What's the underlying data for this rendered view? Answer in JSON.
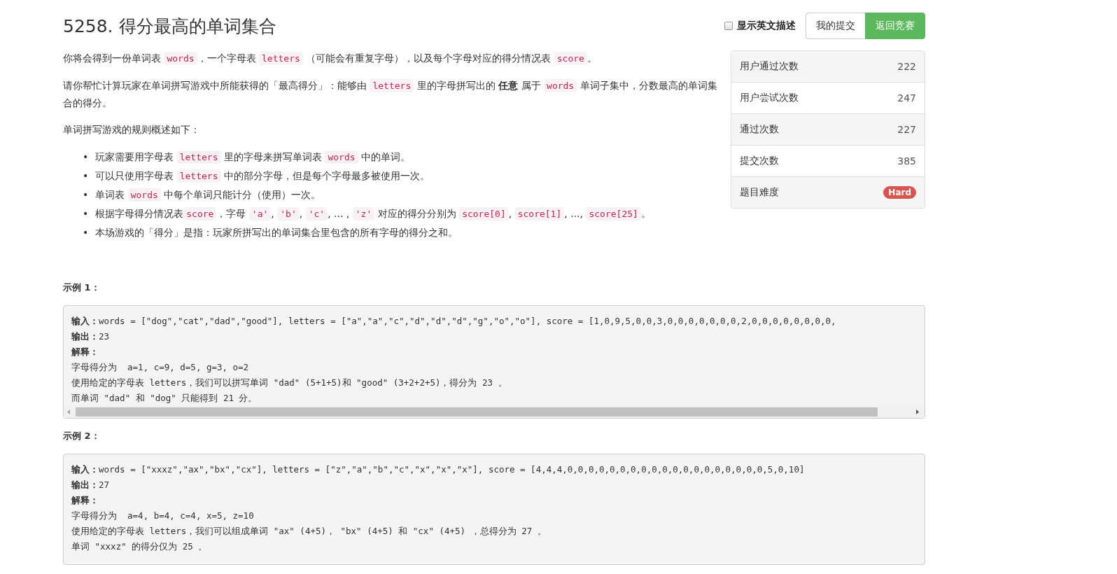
{
  "title": "5258. 得分最高的单词集合",
  "english_toggle": {
    "label": "显示英文描述",
    "checked": false
  },
  "buttons": [
    {
      "label": "我的提交",
      "kind": "default"
    },
    {
      "label": "返回竞赛",
      "kind": "success"
    }
  ],
  "stats": [
    {
      "label": "用户通过次数",
      "value": "222",
      "kind": "count"
    },
    {
      "label": "用户尝试次数",
      "value": "247",
      "kind": "count"
    },
    {
      "label": "通过次数",
      "value": "227",
      "kind": "count"
    },
    {
      "label": "提交次数",
      "value": "385",
      "kind": "count"
    },
    {
      "label": "题目难度",
      "value": "Hard",
      "kind": "badge",
      "color": "#d9534f"
    }
  ],
  "description": [
    [
      {
        "kind": "plain",
        "text": "你将会得到一份单词表 "
      },
      {
        "kind": "code",
        "text": "words"
      },
      {
        "kind": "plain",
        "text": "，一个字母表 "
      },
      {
        "kind": "code",
        "text": "letters"
      },
      {
        "kind": "plain",
        "text": " （可能会有重复字母），以及每个字母对应的得分情况表 "
      },
      {
        "kind": "code",
        "text": "score"
      },
      {
        "kind": "plain",
        "text": "。"
      }
    ],
    [
      {
        "kind": "plain",
        "text": "请你帮忙计算玩家在单词拼写游戏中所能获得的「最高得分」：能够由 "
      },
      {
        "kind": "code",
        "text": "letters"
      },
      {
        "kind": "plain",
        "text": " 里的字母拼写出的 "
      },
      {
        "kind": "bold",
        "text": "任意"
      },
      {
        "kind": "plain",
        "text": " 属于 "
      },
      {
        "kind": "code",
        "text": "words"
      },
      {
        "kind": "plain",
        "text": " 单词子集中，分数最高的单词集合的得分。"
      }
    ],
    [
      {
        "kind": "plain",
        "text": "单词拼写游戏的规则概述如下："
      }
    ]
  ],
  "rules": [
    {
      "marker": "•",
      "segments": [
        {
          "kind": "plain",
          "text": "玩家需要用字母表 "
        },
        {
          "kind": "code",
          "text": "letters"
        },
        {
          "kind": "plain",
          "text": " 里的字母来拼写单词表 "
        },
        {
          "kind": "code",
          "text": "words"
        },
        {
          "kind": "plain",
          "text": " 中的单词。"
        }
      ]
    },
    {
      "marker": "•",
      "segments": [
        {
          "kind": "plain",
          "text": "可以只使用字母表 "
        },
        {
          "kind": "code",
          "text": "letters"
        },
        {
          "kind": "plain",
          "text": " 中的部分字母，但是每个字母最多被使用一次。"
        }
      ]
    },
    {
      "marker": "•",
      "segments": [
        {
          "kind": "plain",
          "text": "单词表 "
        },
        {
          "kind": "code",
          "text": "words"
        },
        {
          "kind": "plain",
          "text": " 中每个单词只能计分（使用）一次。"
        }
      ]
    },
    {
      "marker": "•",
      "segments": [
        {
          "kind": "plain",
          "text": "根据字母得分情况表"
        },
        {
          "kind": "code",
          "text": "score"
        },
        {
          "kind": "plain",
          "text": "，字母 "
        },
        {
          "kind": "code",
          "text": "'a'"
        },
        {
          "kind": "plain",
          "text": ", "
        },
        {
          "kind": "code",
          "text": "'b'"
        },
        {
          "kind": "plain",
          "text": ", "
        },
        {
          "kind": "code",
          "text": "'c'"
        },
        {
          "kind": "plain",
          "text": ", ... , "
        },
        {
          "kind": "code",
          "text": "'z'"
        },
        {
          "kind": "plain",
          "text": " 对应的得分分别为 "
        },
        {
          "kind": "code",
          "text": "score[0]"
        },
        {
          "kind": "plain",
          "text": ", "
        },
        {
          "kind": "code",
          "text": "score[1]"
        },
        {
          "kind": "plain",
          "text": ", ..., "
        },
        {
          "kind": "code",
          "text": "score[25]"
        },
        {
          "kind": "plain",
          "text": "。"
        }
      ]
    },
    {
      "marker": "•",
      "segments": [
        {
          "kind": "plain",
          "text": "本场游戏的「得分」是指：玩家所拼写出的单词集合里包含的所有字母的得分之和。"
        }
      ]
    }
  ],
  "examples": [
    {
      "heading": "示例 1：",
      "scrollable": true,
      "lines": [
        "**输入：**words = [\"dog\",\"cat\",\"dad\",\"good\"], letters = [\"a\",\"a\",\"c\",\"d\",\"d\",\"d\",\"g\",\"o\",\"o\"], score = [1,0,9,5,0,0,3,0,0,0,0,0,0,0,2,0,0,0,0,0,0,0,0,",
        "**输出：**23",
        "**解释：**",
        "字母得分为  a=1, c=9, d=5, g=3, o=2",
        "使用给定的字母表 letters，我们可以拼写单词 \"dad\" (5+1+5)和 \"good\" (3+2+2+5)，得分为 23 。",
        "而单词 \"dad\" 和 \"dog\" 只能得到 21 分。"
      ]
    },
    {
      "heading": "示例 2：",
      "scrollable": false,
      "lines": [
        "**输入：**words = [\"xxxz\",\"ax\",\"bx\",\"cx\"], letters = [\"z\",\"a\",\"b\",\"c\",\"x\",\"x\",\"x\"], score = [4,4,4,0,0,0,0,0,0,0,0,0,0,0,0,0,0,0,0,0,0,0,5,0,10]",
        "**输出：**27",
        "**解释：**",
        "字母得分为  a=4, b=4, c=4, x=5, z=10",
        "使用给定的字母表 letters，我们可以组成单词 \"ax\" (4+5)， \"bx\" (4+5) 和 \"cx\" (4+5) ，总得分为 27 。",
        "单词 \"xxxz\" 的得分仅为 25 。"
      ]
    }
  ]
}
